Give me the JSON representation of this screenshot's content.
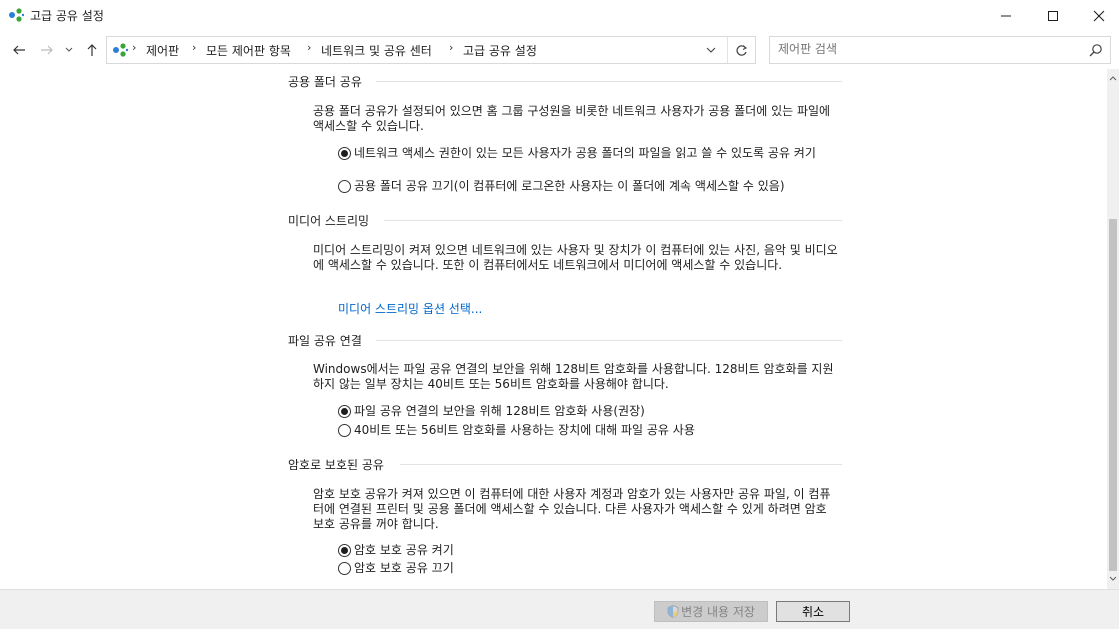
{
  "window": {
    "title": "고급 공유 설정",
    "minimize_glyph": "—",
    "maximize_glyph": "☐",
    "close_glyph": "✕"
  },
  "nav": {
    "back_glyph": "←",
    "forward_glyph": "→",
    "recent_glyph": "⌄",
    "up_glyph": "↑"
  },
  "breadcrumb": {
    "items": [
      "제어판",
      "모든 제어판 항목",
      "네트워크 및 공유 센터",
      "고급 공유 설정"
    ],
    "separator": "›"
  },
  "search": {
    "placeholder": "제어판 검색"
  },
  "sections": {
    "public_folder": {
      "heading": "공용 폴더 공유",
      "description": "공용 폴더 공유가 설정되어 있으면 홈 그룹 구성원을 비롯한 네트워크 사용자가 공용 폴더에 있는 파일에 액세스할 수 있습니다.",
      "options": [
        {
          "label": "네트워크 액세스 권한이 있는 모든 사용자가 공용 폴더의 파일을 읽고 쓸 수 있도록 공유 켜기",
          "checked": true
        },
        {
          "label": "공용 폴더 공유 끄기(이 컴퓨터에 로그온한 사용자는 이 폴더에 계속 액세스할 수 있음)",
          "checked": false
        }
      ]
    },
    "media_streaming": {
      "heading": "미디어 스트리밍",
      "description": "미디어 스트리밍이 켜져 있으면 네트워크에 있는 사용자 및 장치가 이 컴퓨터에 있는 사진, 음악 및 비디오에 액세스할 수 있습니다. 또한 이 컴퓨터에서도 네트워크에서 미디어에 액세스할 수 있습니다.",
      "link": "미디어 스트리밍 옵션 선택..."
    },
    "file_sharing": {
      "heading": "파일 공유 연결",
      "description": "Windows에서는 파일 공유 연결의 보안을 위해 128비트 암호화를 사용합니다. 128비트 암호화를 지원하지 않는 일부 장치는 40비트 또는 56비트 암호화를 사용해야 합니다.",
      "options": [
        {
          "label": "파일 공유 연결의 보안을 위해 128비트 암호화 사용(권장)",
          "checked": true
        },
        {
          "label": "40비트 또는 56비트 암호화를 사용하는 장치에 대해 파일 공유 사용",
          "checked": false
        }
      ]
    },
    "password_protected": {
      "heading": "암호로 보호된 공유",
      "description": "암호 보호 공유가 켜져 있으면 이 컴퓨터에 대한 사용자 계정과 암호가 있는 사용자만 공유 파일, 이 컴퓨터에 연결된 프린터 및 공용 폴더에 액세스할 수 있습니다. 다른 사용자가 액세스할 수 있게 하려면 암호 보호 공유를 꺼야 합니다.",
      "options": [
        {
          "label": "암호 보호 공유 켜기",
          "checked": true
        },
        {
          "label": "암호 보호 공유 끄기",
          "checked": false
        }
      ]
    }
  },
  "footer": {
    "save_label": "변경 내용 저장",
    "cancel_label": "취소"
  },
  "colors": {
    "link": "#0066cc",
    "accent_icon": "#2b7fd6",
    "network_green": "#3aa53a"
  }
}
